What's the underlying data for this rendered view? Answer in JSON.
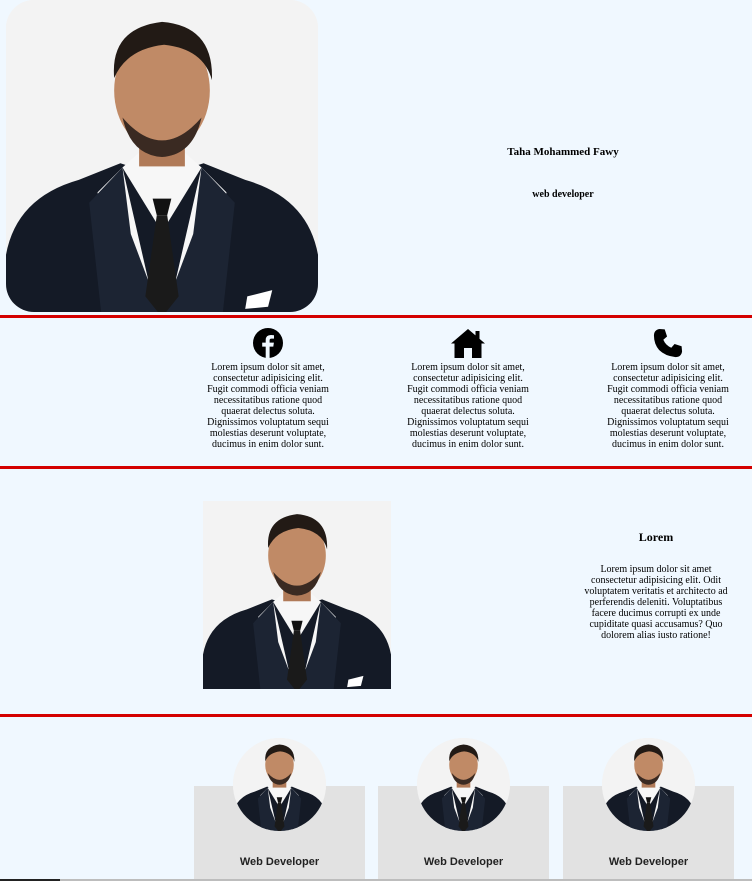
{
  "hero": {
    "name": "Taha Mohammed Fawy",
    "role": "web developer"
  },
  "features": [
    {
      "icon": "facebook-icon",
      "text": "Lorem ipsum dolor sit amet, consectetur adipisicing elit. Fugit commodi officia veniam necessitatibus ratione quod quaerat delectus soluta. Dignissimos voluptatum sequi molestias deserunt voluptate, ducimus in enim dolor sunt."
    },
    {
      "icon": "home-icon",
      "text": "Lorem ipsum dolor sit amet, consectetur adipisicing elit. Fugit commodi officia veniam necessitatibus ratione quod quaerat delectus soluta. Dignissimos voluptatum sequi molestias deserunt voluptate, ducimus in enim dolor sunt."
    },
    {
      "icon": "phone-icon",
      "text": "Lorem ipsum dolor sit amet, consectetur adipisicing elit. Fugit commodi officia veniam necessitatibus ratione quod quaerat delectus soluta. Dignissimos voluptatum sequi molestias deserunt voluptate, ducimus in enim dolor sunt."
    }
  ],
  "about": {
    "title": "Lorem",
    "text": "Lorem ipsum dolor sit amet consectetur adipisicing elit. Odit voluptatem veritatis et architecto ad perferendis deleniti. Voluptatibus facere ducimus corrupti ex unde cupiditate quasi accusamus? Quo dolorem alias iusto ratione!"
  },
  "cards": [
    {
      "label": "Web Developer"
    },
    {
      "label": "Web Developer"
    },
    {
      "label": "Web Developer"
    }
  ],
  "colors": {
    "background": "#f0f8ff",
    "divider": "#d40000",
    "card": "#e2e2e2"
  }
}
